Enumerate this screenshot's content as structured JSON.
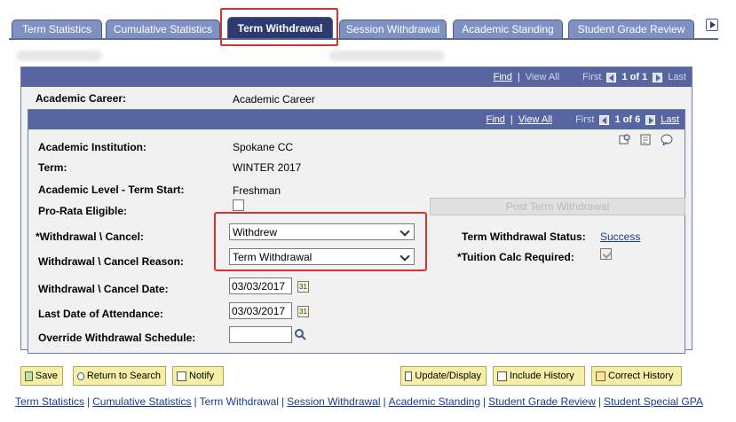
{
  "tabs": [
    {
      "label": "Term Statistics",
      "active": false
    },
    {
      "label": "Cumulative Statistics",
      "active": false
    },
    {
      "label": "Term Withdrawal",
      "active": true
    },
    {
      "label": "Session Withdrawal",
      "active": false
    },
    {
      "label": "Academic Standing",
      "active": false
    },
    {
      "label": "Student Grade Review",
      "active": false
    }
  ],
  "outer_nav": {
    "find": "Find",
    "view_all": "View All",
    "first": "First",
    "count": "1 of 1",
    "last": "Last"
  },
  "career": {
    "label": "Academic Career:",
    "value": "Academic Career"
  },
  "inner_nav": {
    "find": "Find",
    "view_all": "View All",
    "first": "First",
    "count": "1 of 6",
    "last": "Last"
  },
  "fields": {
    "institution_label": "Academic Institution:",
    "institution_value": "Spokane CC",
    "term_label": "Term:",
    "term_value": "WINTER 2017",
    "level_label": "Academic Level - Term Start:",
    "level_value": "Freshman",
    "prorata_label": "Pro-Rata Eligible:",
    "post_button": "Post Term Withdrawal",
    "withdrawal_cancel_label": "*Withdrawal \\ Cancel:",
    "withdrawal_cancel_value": "Withdrew",
    "reason_label": "Withdrawal \\ Cancel Reason:",
    "reason_value": "Term Withdrawal",
    "status_label": "Term Withdrawal Status:",
    "status_value": "Success",
    "tuition_label": "*Tuition Calc Required:",
    "cancel_date_label": "Withdrawal \\ Cancel Date:",
    "cancel_date_value": "03/03/2017",
    "last_attend_label": "Last Date of Attendance:",
    "last_attend_value": "03/03/2017",
    "override_label": "Override Withdrawal Schedule:",
    "override_value": ""
  },
  "toolbar": {
    "save": "Save",
    "return": "Return to Search",
    "notify": "Notify",
    "update": "Update/Display",
    "include_history": "Include History",
    "correct_history": "Correct History"
  },
  "footer_links": [
    "Term Statistics",
    "Cumulative Statistics",
    "Term Withdrawal",
    "Session Withdrawal",
    "Academic Standing",
    "Student Grade Review",
    "Student Special GPA"
  ],
  "colors": {
    "tab": "#7f91c1",
    "tab_active": "#2d3a70",
    "navbar": "#5766a0",
    "highlight": "#d9342b",
    "button": "#f5efa8"
  }
}
